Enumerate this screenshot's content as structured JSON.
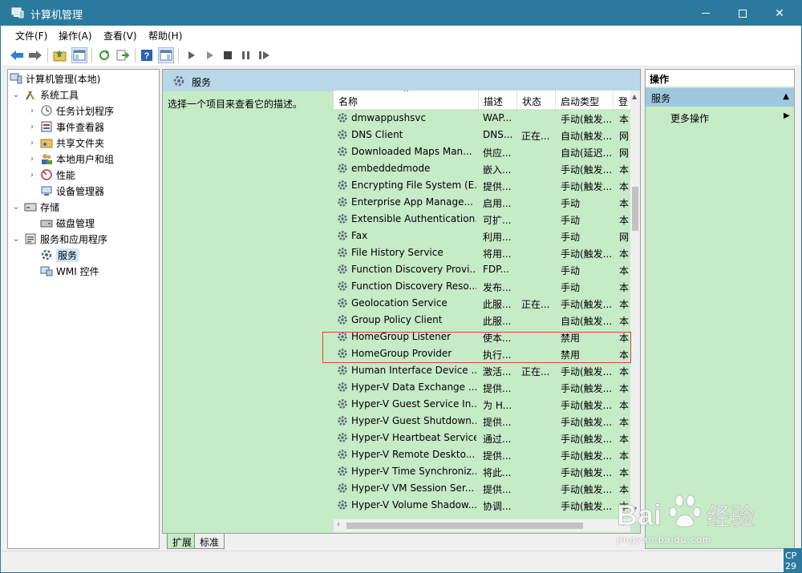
{
  "window": {
    "title": "计算机管理",
    "accent": "#2b7a9d"
  },
  "menu": [
    {
      "label": "文件(F)"
    },
    {
      "label": "操作(A)"
    },
    {
      "label": "查看(V)"
    },
    {
      "label": "帮助(H)"
    }
  ],
  "tree": {
    "items": [
      {
        "label": "计算机管理(本地)",
        "icon": "computer-icon"
      },
      {
        "label": "系统工具",
        "icon": "tools-icon"
      },
      {
        "label": "任务计划程序",
        "icon": "clock-icon"
      },
      {
        "label": "事件查看器",
        "icon": "event-viewer-icon"
      },
      {
        "label": "共享文件夹",
        "icon": "shared-folder-icon"
      },
      {
        "label": "本地用户和组",
        "icon": "users-icon"
      },
      {
        "label": "性能",
        "icon": "performance-icon"
      },
      {
        "label": "设备管理器",
        "icon": "device-manager-icon"
      },
      {
        "label": "存储",
        "icon": "storage-icon"
      },
      {
        "label": "磁盘管理",
        "icon": "disk-icon"
      },
      {
        "label": "服务和应用程序",
        "icon": "services-apps-icon"
      },
      {
        "label": "服务",
        "icon": "services-icon"
      },
      {
        "label": "WMI 控件",
        "icon": "wmi-icon"
      }
    ]
  },
  "center": {
    "header": "服务",
    "description": "选择一个项目来查看它的描述。",
    "columns": [
      "名称",
      "描述",
      "状态",
      "启动类型",
      "登"
    ],
    "rows": [
      {
        "name": "dmwappushsvc",
        "desc": "WAP...",
        "status": "",
        "startup": "手动(触发...",
        "logon": "本"
      },
      {
        "name": "DNS Client",
        "desc": "DNS...",
        "status": "正在...",
        "startup": "自动(触发...",
        "logon": "网"
      },
      {
        "name": "Downloaded Maps Man...",
        "desc": "供应...",
        "status": "",
        "startup": "自动(延迟...",
        "logon": "网"
      },
      {
        "name": "embeddedmode",
        "desc": "嵌入...",
        "status": "",
        "startup": "手动(触发...",
        "logon": "本"
      },
      {
        "name": "Encrypting File System (E...",
        "desc": "提供...",
        "status": "",
        "startup": "手动(触发...",
        "logon": "本"
      },
      {
        "name": "Enterprise App Manage...",
        "desc": "启用...",
        "status": "",
        "startup": "手动",
        "logon": "本"
      },
      {
        "name": "Extensible Authentication...",
        "desc": "可扩...",
        "status": "",
        "startup": "手动",
        "logon": "本"
      },
      {
        "name": "Fax",
        "desc": "利用...",
        "status": "",
        "startup": "手动",
        "logon": "网"
      },
      {
        "name": "File History Service",
        "desc": "将用...",
        "status": "",
        "startup": "手动(触发...",
        "logon": "本"
      },
      {
        "name": "Function Discovery Provi...",
        "desc": "FDP...",
        "status": "",
        "startup": "手动",
        "logon": "本"
      },
      {
        "name": "Function Discovery Reso...",
        "desc": "发布...",
        "status": "",
        "startup": "手动",
        "logon": "本"
      },
      {
        "name": "Geolocation Service",
        "desc": "此服...",
        "status": "正在...",
        "startup": "手动(触发...",
        "logon": "本"
      },
      {
        "name": "Group Policy Client",
        "desc": "此服...",
        "status": "",
        "startup": "自动(触发...",
        "logon": "本"
      },
      {
        "name": "HomeGroup Listener",
        "desc": "使本...",
        "status": "",
        "startup": "禁用",
        "logon": "本"
      },
      {
        "name": "HomeGroup Provider",
        "desc": "执行...",
        "status": "",
        "startup": "禁用",
        "logon": "本"
      },
      {
        "name": "Human Interface Device ...",
        "desc": "激活...",
        "status": "正在...",
        "startup": "手动(触发...",
        "logon": "本"
      },
      {
        "name": "Hyper-V Data Exchange ...",
        "desc": "提供...",
        "status": "",
        "startup": "手动(触发...",
        "logon": "本"
      },
      {
        "name": "Hyper-V Guest Service In...",
        "desc": "为 H...",
        "status": "",
        "startup": "手动(触发...",
        "logon": "本"
      },
      {
        "name": "Hyper-V Guest Shutdown...",
        "desc": "提供...",
        "status": "",
        "startup": "手动(触发...",
        "logon": "本"
      },
      {
        "name": "Hyper-V Heartbeat Service",
        "desc": "通过...",
        "status": "",
        "startup": "手动(触发...",
        "logon": "本"
      },
      {
        "name": "Hyper-V Remote Deskto...",
        "desc": "提供...",
        "status": "",
        "startup": "手动(触发...",
        "logon": "本"
      },
      {
        "name": "Hyper-V Time Synchroniz...",
        "desc": "将此...",
        "status": "",
        "startup": "手动(触发...",
        "logon": "本"
      },
      {
        "name": "Hyper-V VM Session Ser...",
        "desc": "提供...",
        "status": "",
        "startup": "手动(触发...",
        "logon": "本"
      },
      {
        "name": "Hyper-V Volume Shadow...",
        "desc": "协调...",
        "status": "",
        "startup": "手动(触发...",
        "logon": "本"
      }
    ]
  },
  "tabs": [
    {
      "label": "扩展"
    },
    {
      "label": "标准"
    }
  ],
  "actions": {
    "header": "操作",
    "section": "服务",
    "item": "更多操作"
  },
  "watermark": {
    "brand": "Bai du 经验",
    "url": "jingyan.baidu.com"
  },
  "corner_badge": "CP 29",
  "colors": {
    "pane_bg": "#c5ebc7",
    "highlight": "#e04040"
  }
}
